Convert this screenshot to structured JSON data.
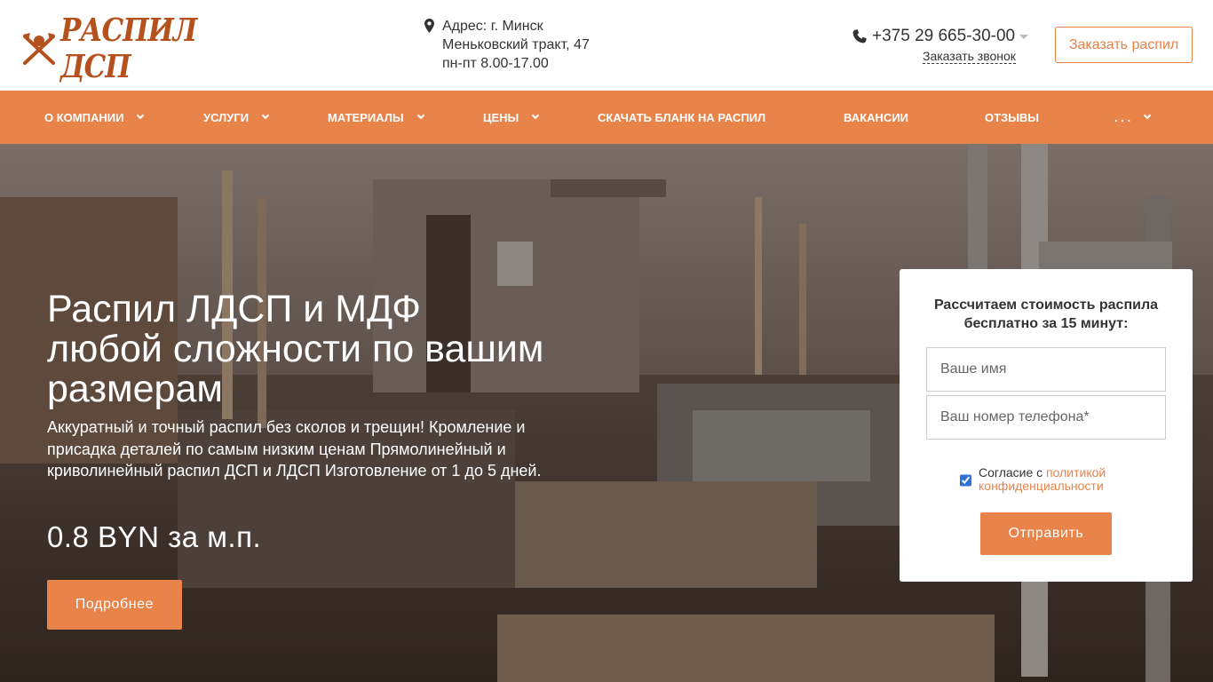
{
  "header": {
    "logo_text": "РАСПИЛ ДСП",
    "address_line1": "Адрес: г. Минск",
    "address_line2": "Меньковский тракт, 47",
    "address_line3": "пн-пт 8.00-17.00",
    "phone": "+375 29 665-30-00",
    "callback_label": "Заказать звонок",
    "order_button": "Заказать распил"
  },
  "nav": {
    "items": [
      {
        "label": "О компании",
        "has_dropdown": true
      },
      {
        "label": "Услуги",
        "has_dropdown": true
      },
      {
        "label": "Материалы",
        "has_dropdown": true
      },
      {
        "label": "Цены",
        "has_dropdown": true
      },
      {
        "label": "Скачать бланк на распил",
        "has_dropdown": false
      },
      {
        "label": "Вакансии",
        "has_dropdown": false
      },
      {
        "label": "Отзывы",
        "has_dropdown": false
      },
      {
        "label": ". . .",
        "has_dropdown": true
      }
    ]
  },
  "hero": {
    "title": "Распил ЛДСП и МДФ любой сложности по вашим размерам",
    "description": "Аккуратный и точный распил без сколов и трещин! Кромление и присадка деталей по самым низким ценам Прямолинейный и криволинейный распил ДСП и ЛДСП Изготовление от 1 до 5 дней.",
    "price": "0.8 BYN за м.п.",
    "more_button": "Подробнее"
  },
  "form": {
    "title": "Рассчитаем стоимость распила бесплатно за 15 минут:",
    "name_placeholder": "Ваше имя",
    "phone_placeholder": "Ваш номер телефона*",
    "consent_text": "Согласие с ",
    "consent_link": "политикой конфиденциальности",
    "consent_checked": true,
    "submit_button": "Отправить"
  },
  "colors": {
    "accent": "#e8834a",
    "logo": "#b5511d",
    "text": "#333333"
  }
}
